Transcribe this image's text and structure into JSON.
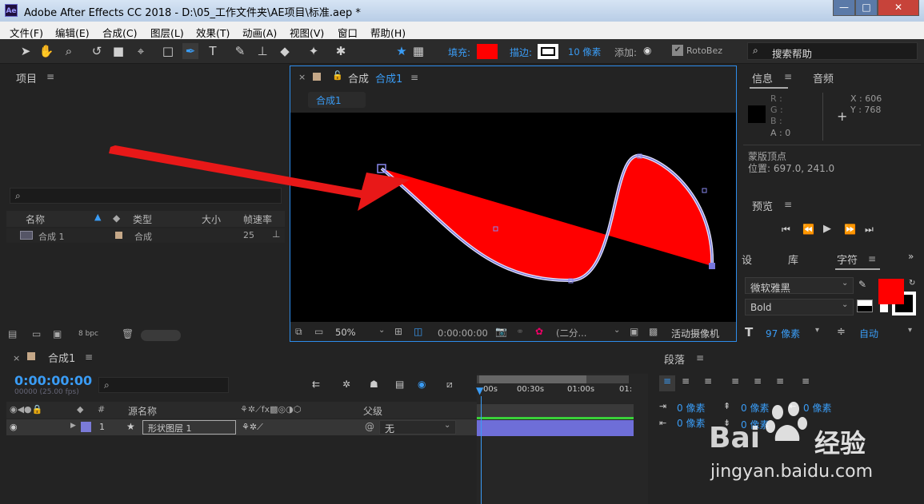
{
  "titlebar": {
    "title": "Adobe After Effects CC 2018 - D:\\05_工作文件夹\\AE项目\\标准.aep *",
    "icon_text": "Ae",
    "min": "—",
    "max": "□",
    "close": "✕"
  },
  "menu": [
    "文件(F)",
    "编辑(E)",
    "合成(C)",
    "图层(L)",
    "效果(T)",
    "动画(A)",
    "视图(V)",
    "窗口",
    "帮助(H)"
  ],
  "toolbar": {
    "fill_label": "填充:",
    "stroke_label": "描边:",
    "stroke_width": "10 像素",
    "add_label": "添加:",
    "rotobezier": "RotoBez",
    "search_placeholder": "搜索帮助",
    "fill_color": "#ff0000"
  },
  "project": {
    "title": "项目",
    "cols": {
      "name": "名称",
      "type": "类型",
      "size": "大小",
      "fps": "帧速率"
    },
    "item": {
      "name": "合成 1",
      "type": "合成",
      "fps": "25"
    },
    "bpc": "8 bpc"
  },
  "comp": {
    "tab_prefix": "合成",
    "tab_name": "合成1",
    "sub_tab": "合成1",
    "zoom": "50%",
    "timecode": "0:00:00:00",
    "quality": "(二分...",
    "camera": "活动摄像机",
    "shape_color": "#ff0000"
  },
  "info": {
    "tab": "信息",
    "tab2": "音频",
    "r": "R :",
    "g": "G :",
    "b": "B :",
    "a": "A : 0",
    "x": "X : 606",
    "y": "Y : 768",
    "line1": "蒙版顶点",
    "line2": "位置: 697.0, 241.0"
  },
  "preview": {
    "title": "预览"
  },
  "char": {
    "tabs": [
      "设",
      "库",
      "字符"
    ],
    "font": "微软雅黑",
    "style": "Bold",
    "size": "97 像素",
    "lead": "自动",
    "color": "#ff0000"
  },
  "timeline": {
    "tab": "合成1",
    "timecode": "0:00:00:00",
    "fps": "00000 (25.00 fps)",
    "col_src": "源名称",
    "col_parent": "父级",
    "layer_num": "1",
    "layer_name": "形状图层 1",
    "parent_val": "无",
    "ruler": [
      "00s",
      "00:30s",
      "01:00s",
      "01:"
    ]
  },
  "para": {
    "title": "段落",
    "v": "0 像素"
  },
  "watermark": {
    "brand": "Bai",
    "brand2": "经验",
    "url": "jingyan.baidu.com"
  }
}
